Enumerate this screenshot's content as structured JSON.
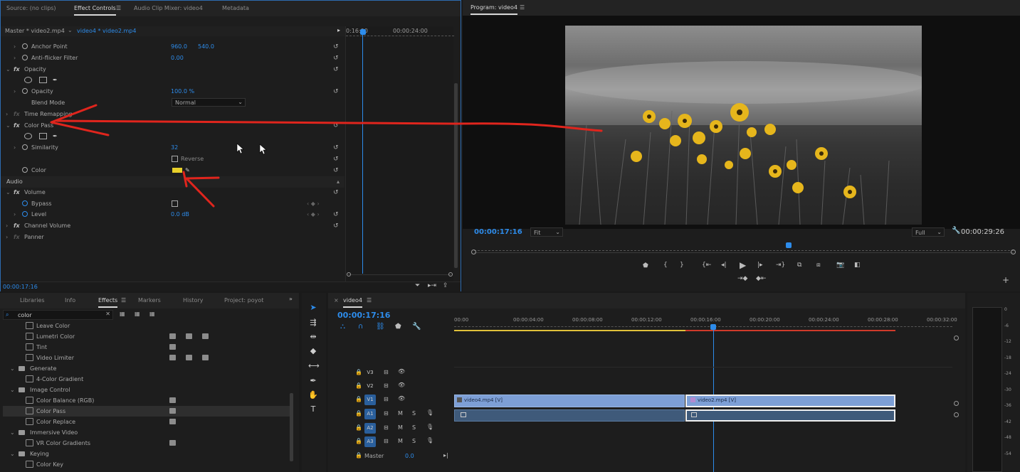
{
  "source_tab": "Source: (no clips)",
  "effect_controls_tab": "Effect Controls",
  "audio_mixer_tab": "Audio Clip Mixer: video4",
  "metadata_tab": "Metadata",
  "master_clip": "Master * video2.mp4",
  "active_clip": "video4 * video2.mp4",
  "ec_time1": "0:16:00",
  "ec_time2": "00:00:24:00",
  "ec_current_time": "00:00:17:16",
  "props": {
    "anchor": "Anchor Point",
    "anchor_x": "960.0",
    "anchor_y": "540.0",
    "antiflicker": "Anti-flicker Filter",
    "antiflicker_val": "0.00",
    "opacity_group": "Opacity",
    "opacity": "Opacity",
    "opacity_val": "100.0 %",
    "blend_mode": "Blend Mode",
    "blend_val": "Normal",
    "time_remap": "Time Remapping",
    "color_pass": "Color Pass",
    "similarity": "Similarity",
    "similarity_val": "32",
    "reverse": "Reverse",
    "color": "Color",
    "audio": "Audio",
    "volume": "Volume",
    "bypass": "Bypass",
    "level": "Level",
    "level_val": "0.0 dB",
    "channel_volume": "Channel Volume",
    "panner": "Panner"
  },
  "program": {
    "title": "Program: video4",
    "timecode": "00:00:17:16",
    "fit": "Fit",
    "quality": "Full",
    "duration": "00:00:29:26"
  },
  "lower_tabs": {
    "libraries": "Libraries",
    "info": "Info",
    "effects": "Effects",
    "markers": "Markers",
    "history": "History",
    "project": "Project: poyot"
  },
  "effects_search": "color",
  "effects_list": [
    {
      "indent": 2,
      "label": "Leave Color",
      "badges": 0
    },
    {
      "indent": 2,
      "label": "Lumetri Color",
      "badges": 3
    },
    {
      "indent": 2,
      "label": "Tint",
      "badges": 1
    },
    {
      "indent": 2,
      "label": "Video Limiter",
      "badges": 3
    },
    {
      "indent": 1,
      "label": "Generate",
      "badges": 0
    },
    {
      "indent": 2,
      "label": "4-Color Gradient",
      "badges": 0
    },
    {
      "indent": 1,
      "label": "Image Control",
      "badges": 0
    },
    {
      "indent": 2,
      "label": "Color Balance (RGB)",
      "badges": 1
    },
    {
      "indent": 2,
      "label": "Color Pass",
      "badges": 1
    },
    {
      "indent": 2,
      "label": "Color Replace",
      "badges": 1
    },
    {
      "indent": 1,
      "label": "Immersive Video",
      "badges": 0
    },
    {
      "indent": 2,
      "label": "VR Color Gradients",
      "badges": 1
    },
    {
      "indent": 1,
      "label": "Keying",
      "badges": 0
    },
    {
      "indent": 2,
      "label": "Color Key",
      "badges": 0
    }
  ],
  "timeline": {
    "seq_name": "video4",
    "timecode": "00:00:17:16",
    "ruler": [
      "00:00",
      "00:00:04:00",
      "00:00:08:00",
      "00:00:12:00",
      "00:00:16:00",
      "00:00:20:00",
      "00:00:24:00",
      "00:00:28:00",
      "00:00:32:00"
    ],
    "tracks": [
      "V3",
      "V2",
      "V1",
      "A1",
      "A2",
      "A3"
    ],
    "master": "Master",
    "master_val": "0.0",
    "clip1": "video4.mp4 [V]",
    "clip2": "video2.mp4 [V]",
    "m": "M",
    "s": "S"
  },
  "meter_scale": [
    "0",
    "-6",
    "-12",
    "-18",
    "-24",
    "-30",
    "-36",
    "-42",
    "-48",
    "-54"
  ],
  "colors": {
    "accent": "#2d8ceb",
    "clip_video": "#7d9fd6",
    "clip_audio": "#3f5a7a",
    "annotation": "#e0251d",
    "keyed": "#e8d02a"
  }
}
